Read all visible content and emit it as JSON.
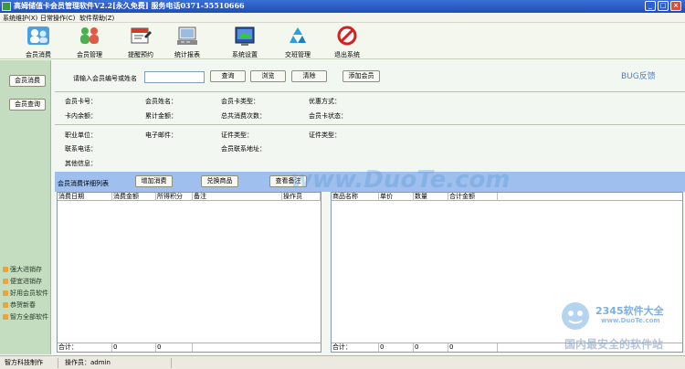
{
  "window": {
    "title": "高姆储值卡会员管理软件V2.2[永久免费] 服务电话0371-55510666",
    "minimize_glyph": "_",
    "maximize_glyph": "□",
    "close_glyph": "×"
  },
  "menu": [
    "系统维护(X)",
    "日常操作(C)",
    "软件帮助(Z)"
  ],
  "toolbar": [
    {
      "label": "会员消费",
      "icon": "users-icon"
    },
    {
      "label": "会员管理",
      "icon": "member-manage-icon"
    },
    {
      "label": "提醒预约",
      "icon": "reminder-icon"
    },
    {
      "label": "统计报表",
      "icon": "report-icon"
    },
    {
      "label": "系统设置",
      "icon": "settings-icon"
    },
    {
      "label": "交班管理",
      "icon": "shift-recycle-icon"
    },
    {
      "label": "退出系统",
      "icon": "exit-icon"
    }
  ],
  "bug_feedback": "BUG反馈",
  "sidebar": {
    "buttons": [
      "会员消费",
      "会员查询"
    ],
    "links": [
      "强大进销存",
      "便宜进销存",
      "好用会员软件",
      "恭贺新春",
      "智方全部软件"
    ]
  },
  "search": {
    "label": "请输入会员编号或姓名",
    "value": "",
    "query_button": "查询",
    "browse_button": "浏览",
    "clear_button": "清除",
    "add_member_button": "添加会员"
  },
  "member_info": {
    "card_no": "会员卡号：",
    "name": "会员姓名：",
    "card_type": "会员卡类型：",
    "discount": "优惠方式：",
    "balance": "卡内余额：",
    "total_amount": "累计金额：",
    "total_count": "总共消费次数：",
    "card_status": "会员卡状态：",
    "company": "职业单位：",
    "email": "电子邮件：",
    "id_type": "证件类型：",
    "id_type2": "证件类型：",
    "phone": "联系电话：",
    "address": "会员联系地址：",
    "other": "其他信息："
  },
  "detail": {
    "title": "会员消费详细列表",
    "add_button": "增加消费",
    "exchange_button": "兑换商品",
    "remark_button": "查看备注"
  },
  "left_table": {
    "columns": [
      "消费日期",
      "消费金额",
      "所得积分",
      "备注",
      "操作员"
    ],
    "footer": [
      "合计：",
      "0",
      "0"
    ]
  },
  "right_table": {
    "columns": [
      "商品名称",
      "单价",
      "数量",
      "合计金额"
    ],
    "footer": [
      "合计：",
      "0",
      "0",
      "0"
    ]
  },
  "watermarks": {
    "duote": "www.DuoTe.com",
    "brand": "2345软件大全",
    "brand_url": "www.DuoTe.com",
    "slogan": "国内最安全的软件站"
  },
  "status": {
    "company": "智方科技制作",
    "operator": "操作员：admin"
  }
}
